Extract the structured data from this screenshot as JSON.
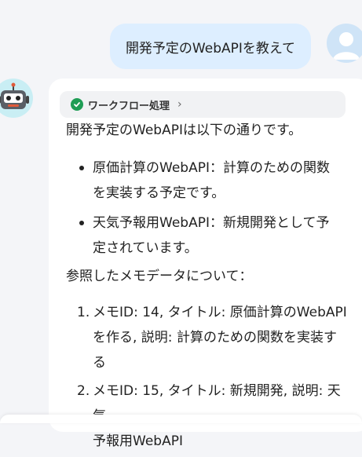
{
  "user_message": "開発予定のWebAPIを教えて",
  "workflow": {
    "label": "ワークフロー処理",
    "icon": "check-circle-icon",
    "status_color": "#1f9d55"
  },
  "answer": {
    "intro": "開発予定のWebAPIは以下の通りです。",
    "bullets": [
      {
        "line1": "原価計算のWebAPI：計算のための関数",
        "line2": "を実装する予定です。"
      },
      {
        "line1": "天気予報用WebAPI：新規開発として予",
        "line2": "定されています。"
      }
    ],
    "meta_heading": "参照したメモデータについて：",
    "references": [
      {
        "marker": "1.",
        "line1": "メモID: 14, タイトル: 原価計算のWebAPI",
        "line2": "を作る, 説明: 計算のための関数を実装す",
        "line3": "る"
      },
      {
        "marker": "2.",
        "line1": "メモID: 15, タイトル: 新規開発, 説明: 天気",
        "line2": "予報用WebAPI"
      }
    ]
  }
}
